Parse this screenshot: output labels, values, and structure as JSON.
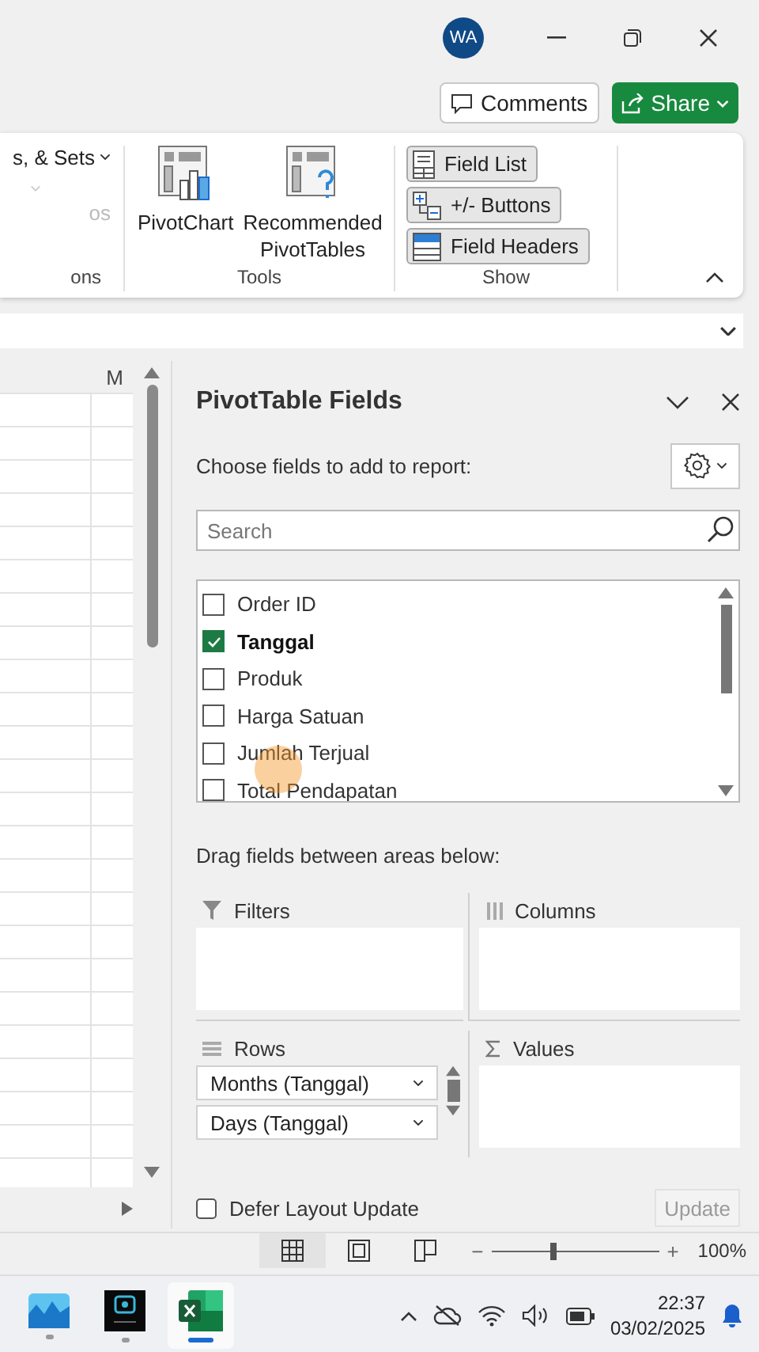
{
  "title_bar": {
    "avatar": "WA"
  },
  "actions": {
    "comments": "Comments",
    "share": "Share"
  },
  "ribbon": {
    "partial_group": {
      "items": [
        {
          "label": "s, & Sets",
          "disabled": false
        },
        {
          "label": "os",
          "disabled": true
        }
      ],
      "label": "ons"
    },
    "tools": {
      "buttons": [
        "PivotChart",
        "Recommended PivotTables"
      ],
      "label": "Tools"
    },
    "show": {
      "buttons": [
        {
          "label": "Field List",
          "selected": true
        },
        {
          "label": "+/- Buttons",
          "selected": true
        },
        {
          "label": "Field Headers",
          "selected": true
        }
      ],
      "label": "Show"
    }
  },
  "sheet": {
    "column_header": "M"
  },
  "pivot_pane": {
    "title": "PivotTable Fields",
    "prompt": "Choose fields to add to report:",
    "search": {
      "placeholder": "Search"
    },
    "fields": [
      {
        "label": "Order ID",
        "checked": false
      },
      {
        "label": "Tanggal",
        "checked": true
      },
      {
        "label": "Produk",
        "checked": false
      },
      {
        "label": "Harga Satuan",
        "checked": false
      },
      {
        "label": "Jumlah Terjual",
        "checked": false
      },
      {
        "label": "Total Pendapatan",
        "checked": false
      }
    ],
    "areas_prompt": "Drag fields between areas below:",
    "areas": [
      {
        "kind": "filters",
        "label": "Filters"
      },
      {
        "kind": "columns",
        "label": "Columns"
      },
      {
        "kind": "rows",
        "label": "Rows",
        "items": [
          "Months (Tanggal)",
          "Days (Tanggal)"
        ]
      },
      {
        "kind": "values",
        "label": "Values"
      }
    ],
    "defer": {
      "label": "Defer Layout Update",
      "checked": false
    },
    "update_button": {
      "label": "Update",
      "disabled": true
    }
  },
  "status_bar": {
    "zoom": {
      "out": "−",
      "in": "+",
      "level": 0.375,
      "reading": "100%"
    }
  },
  "taskbar": {
    "apps": [
      {
        "kind": "photos",
        "selected": false
      },
      {
        "kind": "recorder",
        "selected": false
      },
      {
        "kind": "excel",
        "selected": true
      }
    ],
    "time": "22:37",
    "date": "03/02/2025"
  }
}
